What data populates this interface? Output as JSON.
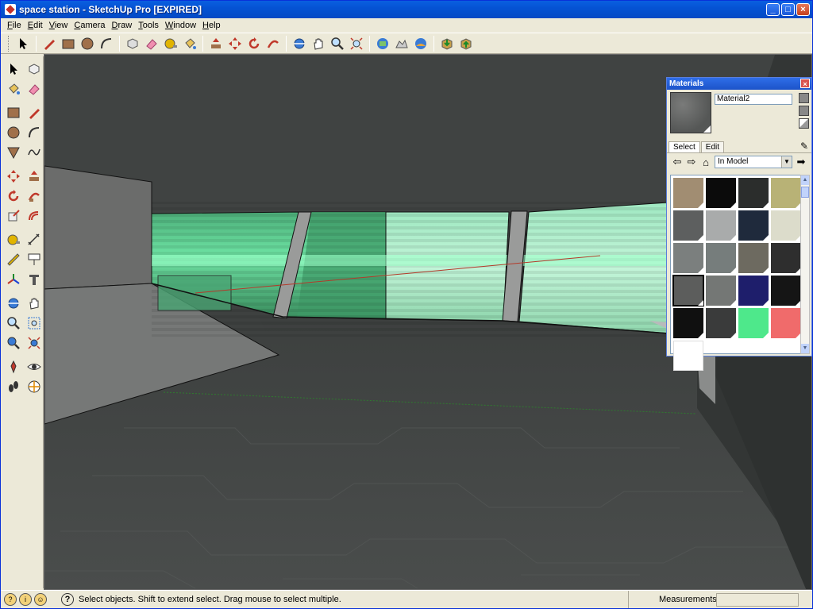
{
  "window": {
    "title": "space station - SketchUp Pro [EXPIRED]"
  },
  "window_buttons": {
    "minimize": "_",
    "maximize": "□",
    "close": "×"
  },
  "menu": [
    {
      "label": "File",
      "accel": "F",
      "rest": "ile"
    },
    {
      "label": "Edit",
      "accel": "E",
      "rest": "dit"
    },
    {
      "label": "View",
      "accel": "V",
      "rest": "iew"
    },
    {
      "label": "Camera",
      "accel": "C",
      "rest": "amera"
    },
    {
      "label": "Draw",
      "accel": "D",
      "rest": "raw"
    },
    {
      "label": "Tools",
      "accel": "T",
      "rest": "ools"
    },
    {
      "label": "Window",
      "accel": "W",
      "rest": "indow"
    },
    {
      "label": "Help",
      "accel": "H",
      "rest": "elp"
    }
  ],
  "materials_panel": {
    "title": "Materials",
    "close": "×",
    "current_material": "Material2",
    "tabs": [
      "Select",
      "Edit"
    ],
    "collection": "In Model",
    "swatches": [
      {
        "color": "#a18d72"
      },
      {
        "color": "#0b0b0b"
      },
      {
        "color": "#2b2d2c"
      },
      {
        "color": "#b8b276"
      },
      {
        "color": "#5d5f5f"
      },
      {
        "color": "#a9abab"
      },
      {
        "color": "#1f2a3c"
      },
      {
        "color": "#dcdccb"
      },
      {
        "color": "#7b7f7e"
      },
      {
        "color": "#767d7c"
      },
      {
        "color": "#6d6a60"
      },
      {
        "color": "#2e2e2e"
      },
      {
        "color": "#5c5d5c",
        "selected": true
      },
      {
        "color": "#747775"
      },
      {
        "color": "#1e1e6b"
      },
      {
        "color": "#151515"
      },
      {
        "color": "#101010"
      },
      {
        "color": "#3a3b3b"
      },
      {
        "color": "#4ee88b"
      },
      {
        "color": "#f06b6b"
      },
      {
        "color": "#ffffff"
      }
    ]
  },
  "status": {
    "hint": "Select objects. Shift to extend select. Drag mouse to select multiple.",
    "measurements_label": "Measurements",
    "measurements_value": "",
    "help_glyph": "?"
  },
  "colors": {
    "viewport_bg": "#3e4140",
    "wall": "#6b6c6b",
    "glass_green": "#59c98c",
    "title_blue": "#0553d4"
  }
}
